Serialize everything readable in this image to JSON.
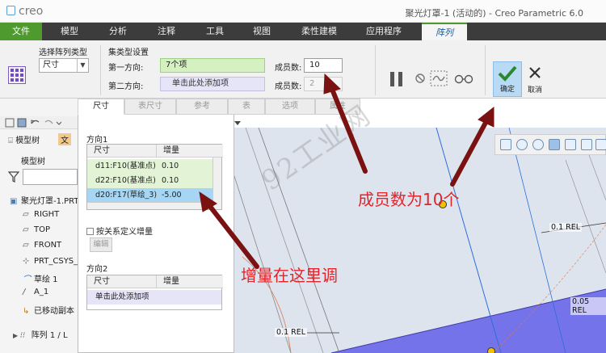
{
  "app": {
    "logo": "creo",
    "window_title": "聚光灯罩-1 (活动的) - Creo Parametric 6.0"
  },
  "ribbon_tabs": [
    {
      "label": "文件"
    },
    {
      "label": "模型"
    },
    {
      "label": "分析"
    },
    {
      "label": "注释"
    },
    {
      "label": "工具"
    },
    {
      "label": "视图"
    },
    {
      "label": "柔性建模"
    },
    {
      "label": "应用程序"
    },
    {
      "label": "阵列"
    }
  ],
  "ribbon": {
    "pattern_type_label": "选择阵列类型",
    "pattern_type_value": "尺寸",
    "settings_label": "集类型设置",
    "dir1_label": "第一方向:",
    "dir1_value": "7个项",
    "dir2_label": "第二方向:",
    "dir2_value": "单击此处添加项",
    "count1_label": "成员数:",
    "count1_value": "10",
    "count2_label": "成员数:",
    "count2_value": "2",
    "ok_label": "确定",
    "cancel_label": "取消"
  },
  "sub_tabs": [
    {
      "label": "尺寸"
    },
    {
      "label": "表尺寸"
    },
    {
      "label": "参考"
    },
    {
      "label": "表"
    },
    {
      "label": "选项"
    },
    {
      "label": "属性"
    }
  ],
  "left": {
    "tab_model_tree": "模型树",
    "tab_other": "文",
    "tree_title": "模型树",
    "items": [
      {
        "label": "聚光灯罩-1.PRT"
      },
      {
        "label": "RIGHT"
      },
      {
        "label": "TOP"
      },
      {
        "label": "FRONT"
      },
      {
        "label": "PRT_CSYS_"
      },
      {
        "label": "草绘 1"
      },
      {
        "label": "A_1"
      },
      {
        "label": "已移动副本"
      },
      {
        "label": "阵列 1 / L"
      }
    ]
  },
  "panel": {
    "dir1_title": "方向1",
    "col_dim": "尺寸",
    "col_inc": "增量",
    "dir1_rows": [
      {
        "dim": "d11:F10(基准点)",
        "inc": "0.10"
      },
      {
        "dim": "d22:F10(基准点)",
        "inc": "0.10"
      },
      {
        "dim": "d20:F17(草绘_3)",
        "inc": "-5.00"
      }
    ],
    "checkbox_label": "按关系定义增量",
    "edit_button": "编辑",
    "dir2_title": "方向2",
    "dir2_placeholder_row": "单击此处添加项"
  },
  "graphics": {
    "dim_labels": [
      {
        "text": "0.1 REL"
      },
      {
        "text": "0.05 REL"
      },
      {
        "text": "0.1 REL"
      }
    ]
  },
  "annotations": {
    "watermark": "92工业网",
    "note_count": "成员数为10个",
    "note_increment": "增量在这里调"
  },
  "colors": {
    "file_tab": "#4e9a2f",
    "annotation_red": "#e2242b",
    "selected_row": "#a6d6f3",
    "green_row": "#e3f3d6",
    "model_face": "#6f6de8"
  }
}
